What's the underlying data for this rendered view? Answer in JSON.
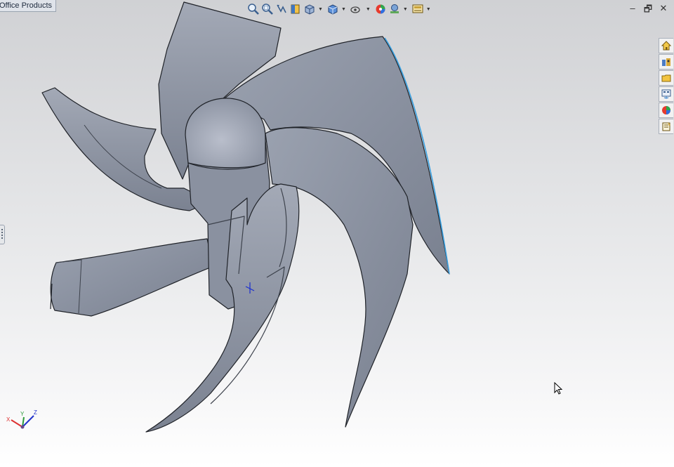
{
  "window": {
    "tab_label": "Office Products"
  },
  "heads_up_toolbar": {
    "items": [
      {
        "name": "zoom-to-fit-icon"
      },
      {
        "name": "zoom-to-area-icon"
      },
      {
        "name": "previous-view-icon"
      },
      {
        "name": "section-view-icon"
      },
      {
        "name": "view-orientation-icon"
      },
      {
        "name": "display-style-icon"
      },
      {
        "name": "hide-show-items-icon"
      },
      {
        "name": "edit-appearance-icon"
      },
      {
        "name": "apply-scene-icon"
      },
      {
        "name": "view-settings-icon"
      }
    ]
  },
  "window_controls": {
    "minimize": "–",
    "restore": "🗗",
    "close": "✕"
  },
  "task_pane": {
    "tabs": [
      {
        "name": "solidworks-resources-icon"
      },
      {
        "name": "design-library-icon"
      },
      {
        "name": "file-explorer-icon"
      },
      {
        "name": "view-palette-icon"
      },
      {
        "name": "appearances-scenes-icon"
      },
      {
        "name": "custom-properties-icon"
      }
    ]
  },
  "triad": {
    "x": "X",
    "y": "Y",
    "z": "Z"
  },
  "colors": {
    "model_fill": "#8e95a4",
    "model_edge": "#1f2228",
    "highlight_edge": "#3aa0e0"
  }
}
